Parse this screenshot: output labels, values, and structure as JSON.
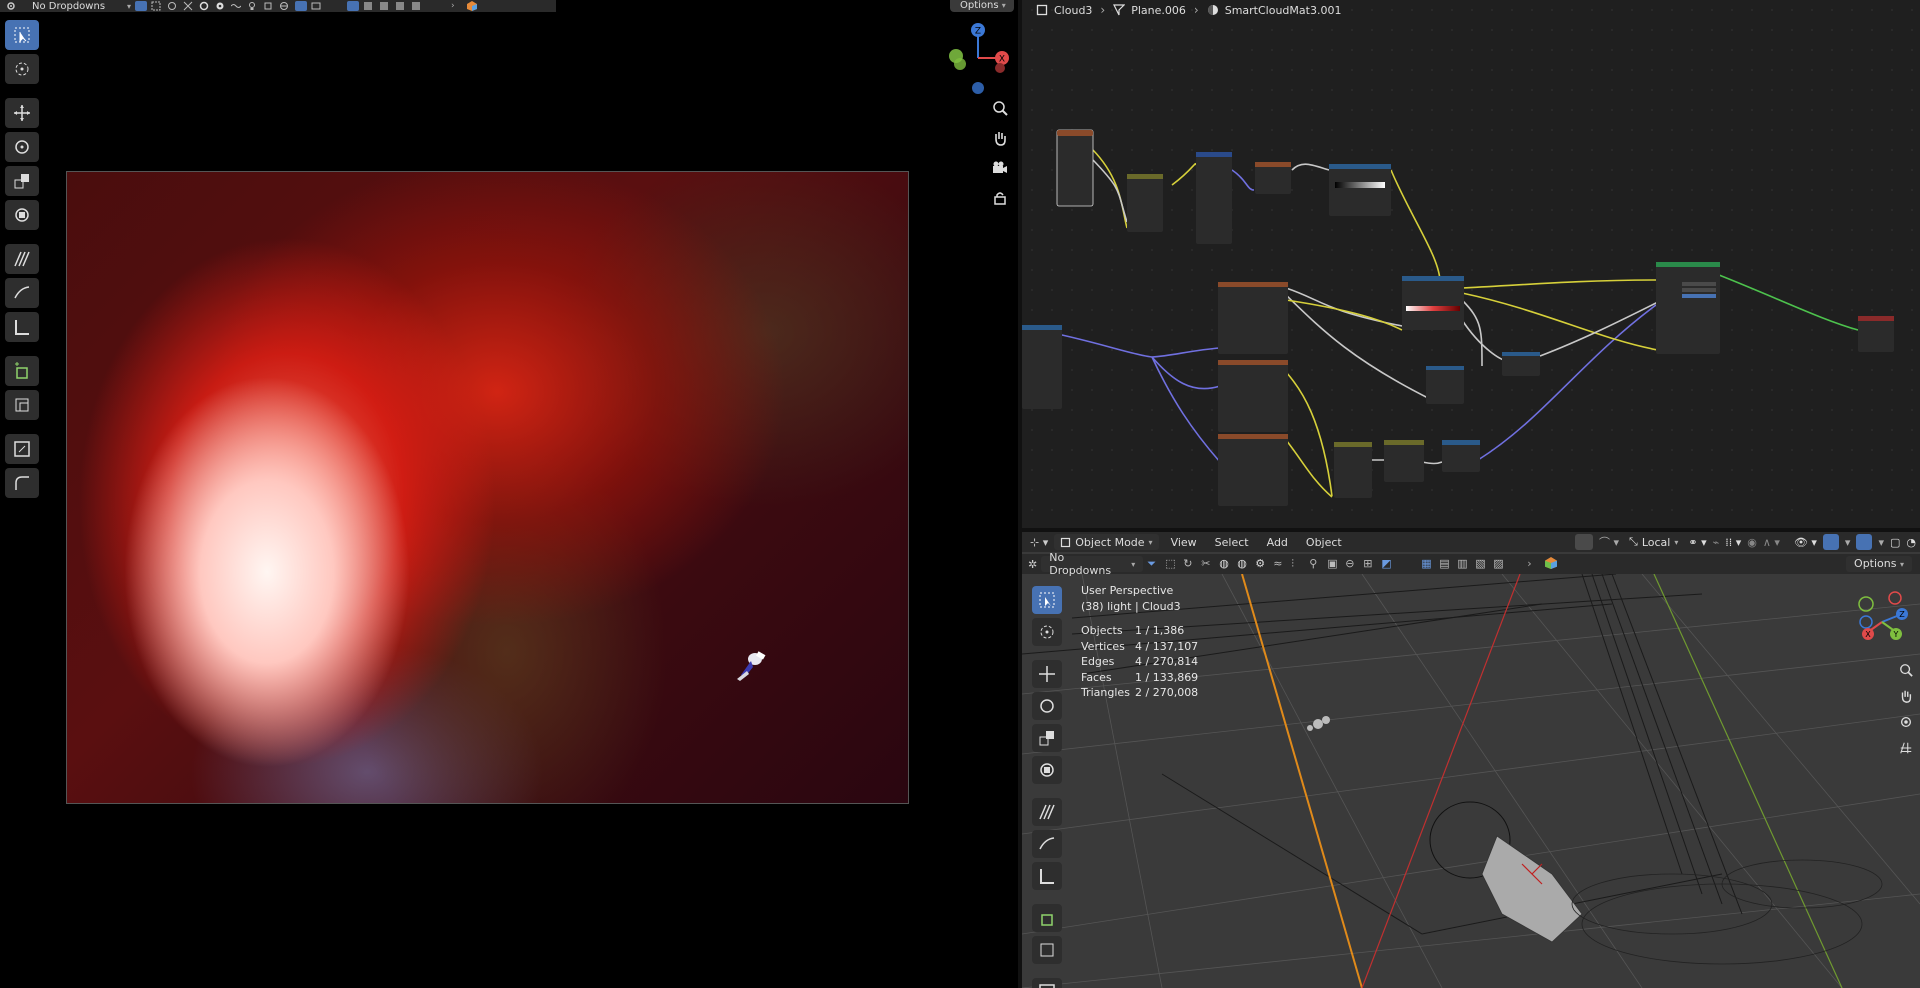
{
  "left_viewport": {
    "dropdown_label": "No Dropdowns",
    "options_label": "Options"
  },
  "node_editor": {
    "breadcrumb": {
      "object": "Cloud3",
      "mesh": "Plane.006",
      "material": "SmartCloudMat3.001"
    }
  },
  "viewport3d": {
    "mode_label": "Object Mode",
    "menus": [
      "View",
      "Select",
      "Add",
      "Object"
    ],
    "transform_orientation": "Local",
    "dropdown_label": "No Dropdowns",
    "options_label": "Options",
    "overlay": {
      "perspective": "User Perspective",
      "collection": "(38) light | Cloud3",
      "stats": [
        {
          "label": "Objects",
          "value": "1 / 1,386"
        },
        {
          "label": "Vertices",
          "value": "4 / 137,107"
        },
        {
          "label": "Edges",
          "value": "4 / 270,814"
        },
        {
          "label": "Faces",
          "value": "1 / 133,869"
        },
        {
          "label": "Triangles",
          "value": "2 / 270,008"
        }
      ]
    }
  },
  "gizmo": {
    "z": "Z",
    "x": "X",
    "y": "Y"
  },
  "colors": {
    "accent": "#4772b3",
    "axis_x": "#e04a4a",
    "axis_y": "#7fbf3f",
    "axis_z": "#3b78d6"
  }
}
